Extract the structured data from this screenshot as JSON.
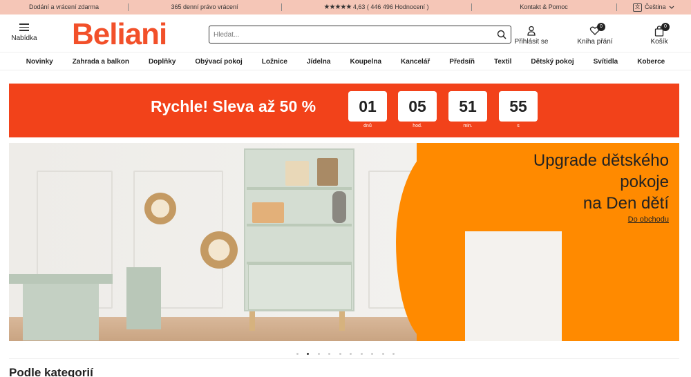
{
  "topbar": {
    "delivery": "Dodání a vrácení zdarma",
    "returns": "365 denní právo vrácení",
    "rating_stars": "★★★★★",
    "rating": "4,63 ( 446 496 Hodnocení )",
    "contact": "Kontakt & Pomoc",
    "language": "Čeština"
  },
  "header": {
    "menu_label": "Nabídka",
    "logo": "Beliani",
    "search_placeholder": "Hledat...",
    "login_label": "Přihlásit se",
    "wishlist_label": "Kniha přání",
    "wishlist_count": "0",
    "cart_label": "Košík",
    "cart_count": "0"
  },
  "categories": [
    "Novinky",
    "Zahrada a balkon",
    "Doplňky",
    "Obývací pokoj",
    "Ložnice",
    "Jídelna",
    "Koupelna",
    "Kancelář",
    "Předsíň",
    "Textil",
    "Dětský pokoj",
    "Svítidla",
    "Koberce"
  ],
  "promo": {
    "text": "Rychle! Sleva až 50 %",
    "countdown": [
      {
        "value": "01",
        "unit": "dnů"
      },
      {
        "value": "05",
        "unit": "hod."
      },
      {
        "value": "51",
        "unit": "min."
      },
      {
        "value": "55",
        "unit": "s"
      }
    ]
  },
  "hero": {
    "title_line1": "Upgrade dětského",
    "title_line2": "pokoje",
    "title_line3": "na Den dětí",
    "link": "Do obchodu",
    "slide_count": 10,
    "active_slide": 2
  },
  "section": {
    "title": "Podle kategorií"
  },
  "colors": {
    "brand": "#f2502a",
    "promo_bg": "#f2421a",
    "topbar_bg": "#f5c6b7",
    "hero_orange": "#ff8a00"
  }
}
